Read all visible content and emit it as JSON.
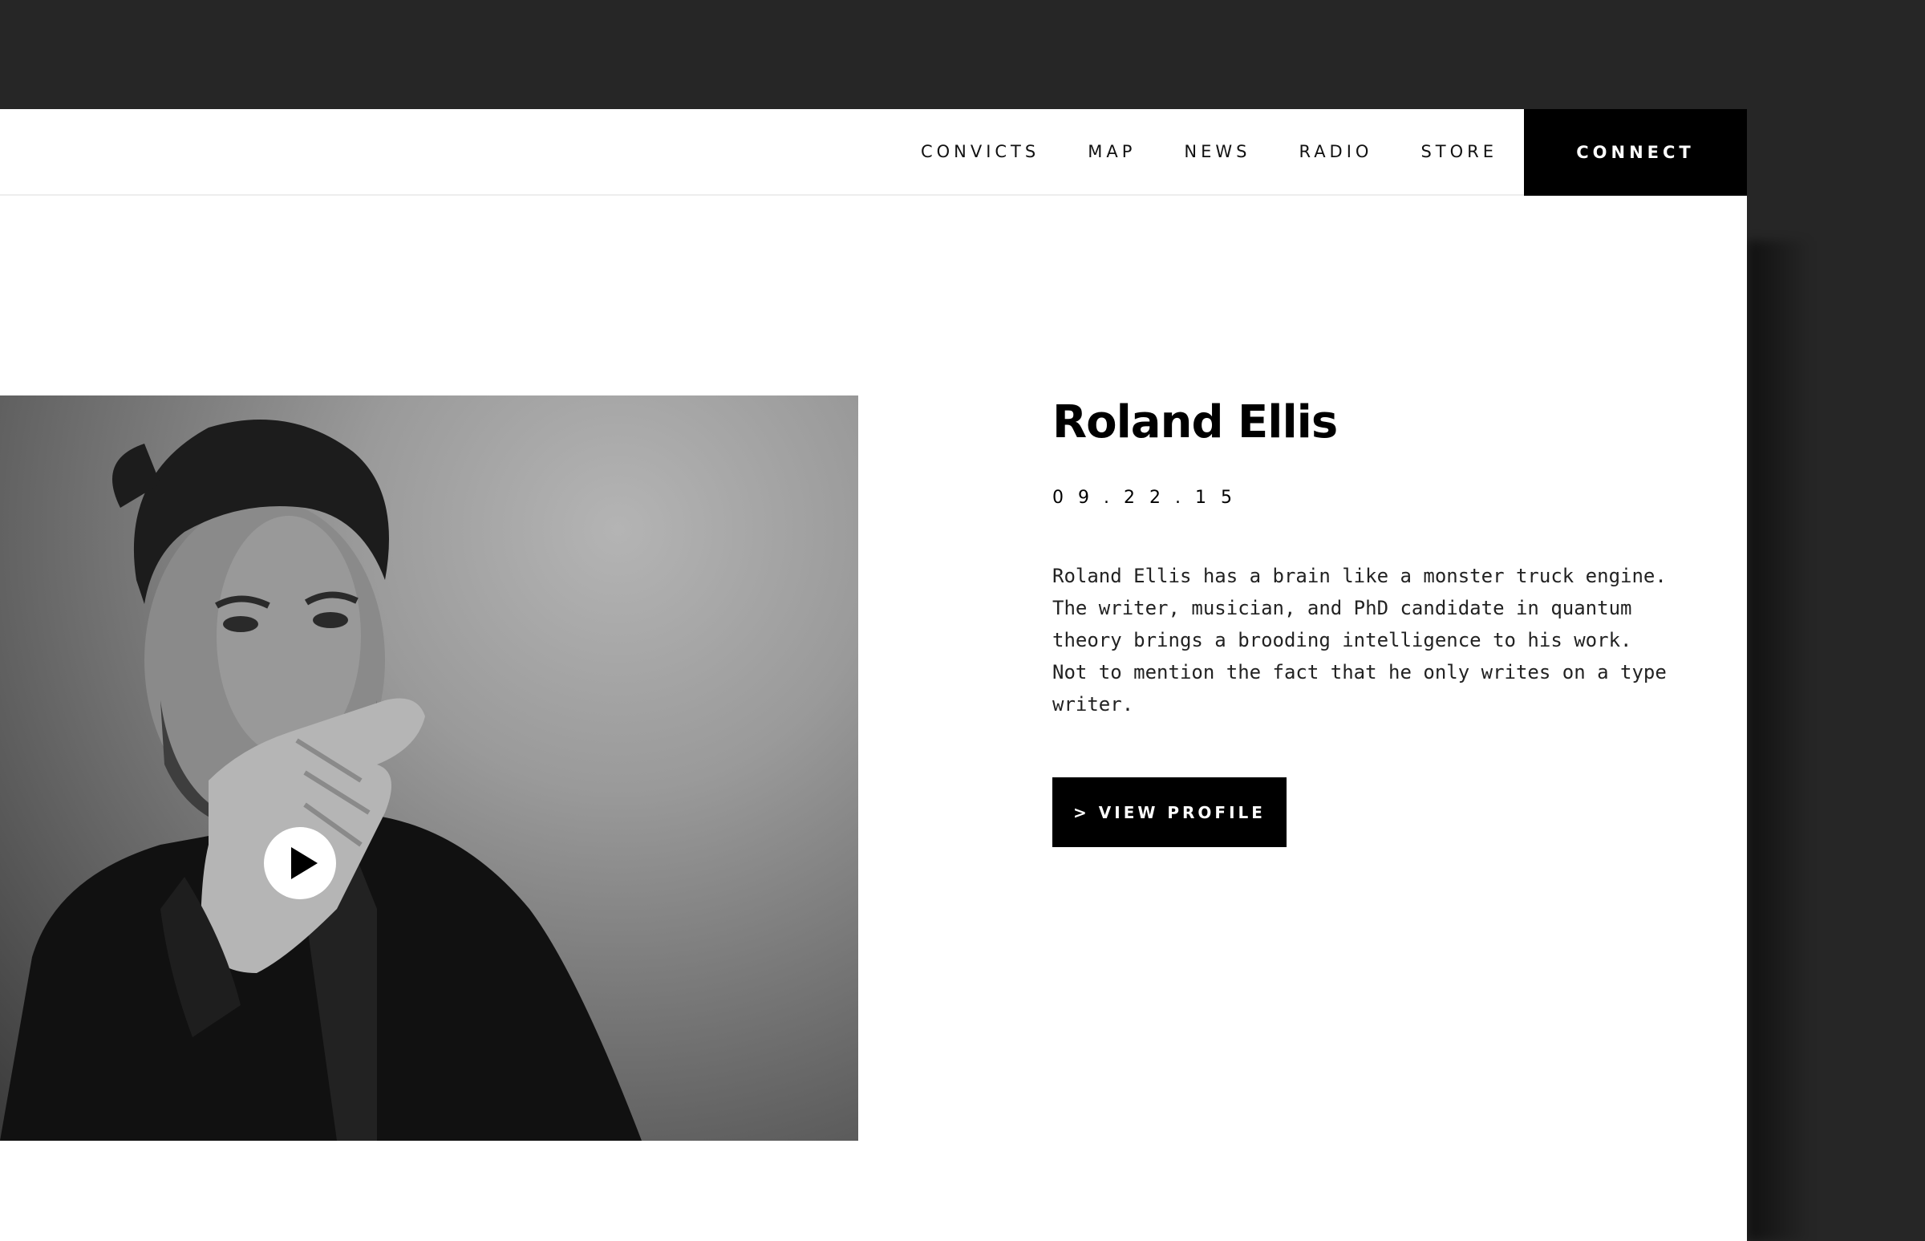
{
  "nav": {
    "links": [
      "CONVICTS",
      "MAP",
      "NEWS",
      "RADIO",
      "STORE"
    ],
    "connect_label": "CONNECT"
  },
  "profile": {
    "name": "Roland Ellis",
    "date": "09.22.15",
    "bio": "Roland Ellis has a brain like a monster truck engine. The writer, musician, and PhD candidate in quantum theory brings a brooding intelligence to his work. Not to mention the fact that he only writes on a type writer.",
    "button_label": "> VIEW PROFILE"
  },
  "media": {
    "photo_icon": "portrait-photo",
    "play_icon": "play-icon"
  },
  "colors": {
    "backdrop": "#262626",
    "page": "#ffffff",
    "accent": "#000000"
  }
}
